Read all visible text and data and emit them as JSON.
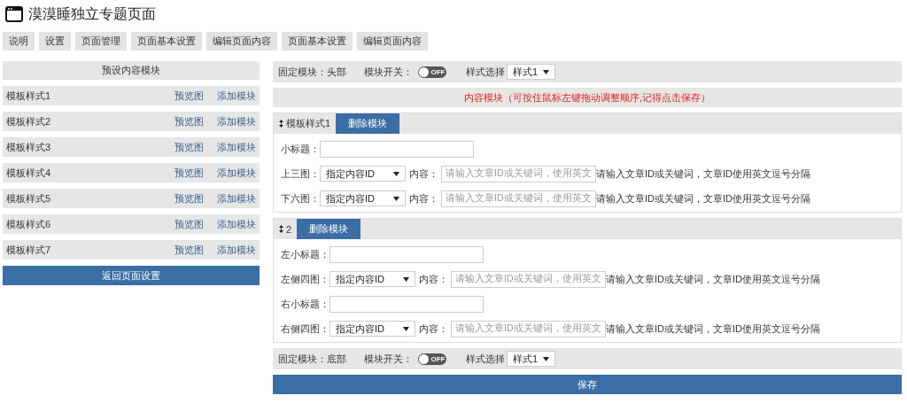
{
  "page": {
    "title": "漠漠睡独立专题页面"
  },
  "tabs": [
    {
      "label": "说明"
    },
    {
      "label": "设置"
    },
    {
      "label": "页面管理"
    },
    {
      "label": "页面基本设置"
    },
    {
      "label": "编辑页面内容"
    },
    {
      "label": "页面基本设置"
    },
    {
      "label": "编辑页面内容"
    }
  ],
  "preset_panel": {
    "heading": "预设内容模块",
    "items": [
      {
        "name": "模板样式1",
        "preview": "预览图",
        "add": "添加模块"
      },
      {
        "name": "模板样式2",
        "preview": "预览图",
        "add": "添加模块"
      },
      {
        "name": "模板样式3",
        "preview": "预览图",
        "add": "添加模块"
      },
      {
        "name": "模板样式4",
        "preview": "预览图",
        "add": "添加模块"
      },
      {
        "name": "模板样式5",
        "preview": "预览图",
        "add": "添加模块"
      },
      {
        "name": "模板样式6",
        "preview": "预览图",
        "add": "添加模块"
      },
      {
        "name": "模板样式7",
        "preview": "预览图",
        "add": "添加模块"
      }
    ],
    "back_button": "返回页面设置"
  },
  "header_module": {
    "label": "固定模块：头部",
    "switch_label": "模块开关：",
    "switch": {
      "on": false,
      "text": "OFF"
    },
    "style_label": "样式选择",
    "style_value": "样式1"
  },
  "notice": "内容模块（可按住鼠标左键拖动调整顺序,记得点击保存）",
  "modules": [
    {
      "title": "模板样式1",
      "delete": "删除模块",
      "fields": [
        {
          "kind": "text",
          "label": "小标题："
        },
        {
          "kind": "select",
          "label": "上三图：",
          "select_value": "指定内容ID",
          "content_label": "内容：",
          "placeholder": "请输入文章ID或关键词，使用英文",
          "hint": "请输入文章ID或关键词，文章ID使用英文逗号分隔"
        },
        {
          "kind": "select",
          "label": "下六图：",
          "select_value": "指定内容ID",
          "content_label": "内容：",
          "placeholder": "请输入文章ID或关键词，使用英文",
          "hint": "请输入文章ID或关键词，文章ID使用英文逗号分隔"
        }
      ]
    },
    {
      "title": "2",
      "delete": "删除模块",
      "fields": [
        {
          "kind": "text",
          "label": "左小标题："
        },
        {
          "kind": "select",
          "label": "左侧四图：",
          "select_value": "指定内容ID",
          "content_label": "内容：",
          "placeholder": "请输入文章ID或关键词，使用英文",
          "hint": "请输入文章ID或关键词，文章ID使用英文逗号分隔"
        },
        {
          "kind": "text",
          "label": "右小标题："
        },
        {
          "kind": "select",
          "label": "右侧四图：",
          "select_value": "指定内容ID",
          "content_label": "内容：",
          "placeholder": "请输入文章ID或关键词，使用英文",
          "hint": "请输入文章ID或关键词，文章ID使用英文逗号分隔"
        }
      ]
    }
  ],
  "footer_module": {
    "label": "固定模块：底部",
    "switch_label": "模块开关：",
    "switch": {
      "on": false,
      "text": "OFF"
    },
    "style_label": "样式选择",
    "style_value": "样式1"
  },
  "save_button": "保存"
}
